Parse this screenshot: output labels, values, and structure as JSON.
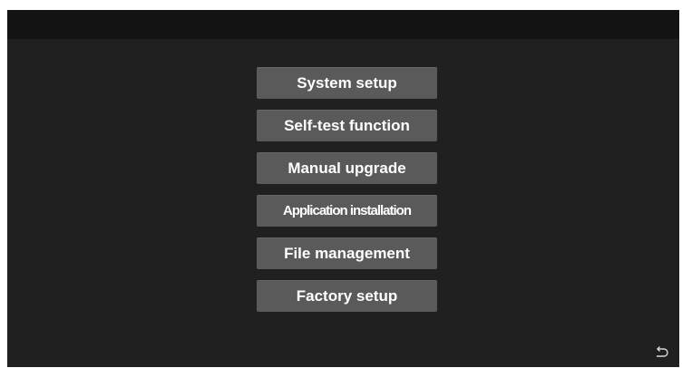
{
  "menu": {
    "items": [
      {
        "label": "System setup"
      },
      {
        "label": "Self-test function"
      },
      {
        "label": "Manual upgrade"
      },
      {
        "label": "Application installation"
      },
      {
        "label": "File management"
      },
      {
        "label": "Factory setup"
      }
    ]
  },
  "icons": {
    "back": "back-arrow-icon"
  },
  "colors": {
    "background": "#202020",
    "status_bar": "#131313",
    "button": "#5a5a5a",
    "text": "#ffffff"
  }
}
